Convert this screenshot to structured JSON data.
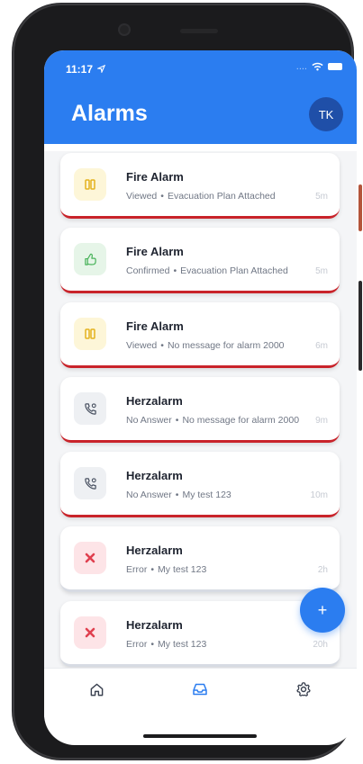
{
  "status_bar": {
    "time": "11:17",
    "signal": "....",
    "wifi_icon": "wifi-icon",
    "battery_icon": "battery-icon"
  },
  "header": {
    "title": "Alarms",
    "avatar_initials": "TK"
  },
  "colors": {
    "accent": "#2b7df0",
    "alert_border": "#c9232a",
    "avatar": "#1f4fa8"
  },
  "alarms": [
    {
      "title": "Fire Alarm",
      "status": "Viewed",
      "message": "Evacuation Plan Attached",
      "time": "5m",
      "icon": "pause-icon",
      "severity": "alert"
    },
    {
      "title": "Fire Alarm",
      "status": "Confirmed",
      "message": "Evacuation Plan Attached",
      "time": "5m",
      "icon": "thumbs-up-icon",
      "severity": "alert"
    },
    {
      "title": "Fire Alarm",
      "status": "Viewed",
      "message": "No message for alarm 2000",
      "time": "6m",
      "icon": "pause-icon",
      "severity": "alert"
    },
    {
      "title": "Herzalarm",
      "status": "No Answer",
      "message": "No message for alarm 2000",
      "time": "9m",
      "icon": "phone-callback-icon",
      "severity": "alert"
    },
    {
      "title": "Herzalarm",
      "status": "No Answer",
      "message": "My test 123",
      "time": "10m",
      "icon": "phone-callback-icon",
      "severity": "alert"
    },
    {
      "title": "Herzalarm",
      "status": "Error",
      "message": "My test 123",
      "time": "2h",
      "icon": "error-x-icon",
      "severity": "plain"
    },
    {
      "title": "Herzalarm",
      "status": "Error",
      "message": "My test 123",
      "time": "20h",
      "icon": "error-x-icon",
      "severity": "plain"
    }
  ],
  "separator": "•",
  "fab": {
    "label": "+"
  },
  "nav": [
    {
      "icon": "home-icon"
    },
    {
      "icon": "inbox-icon",
      "active": true
    },
    {
      "icon": "gear-icon"
    }
  ]
}
